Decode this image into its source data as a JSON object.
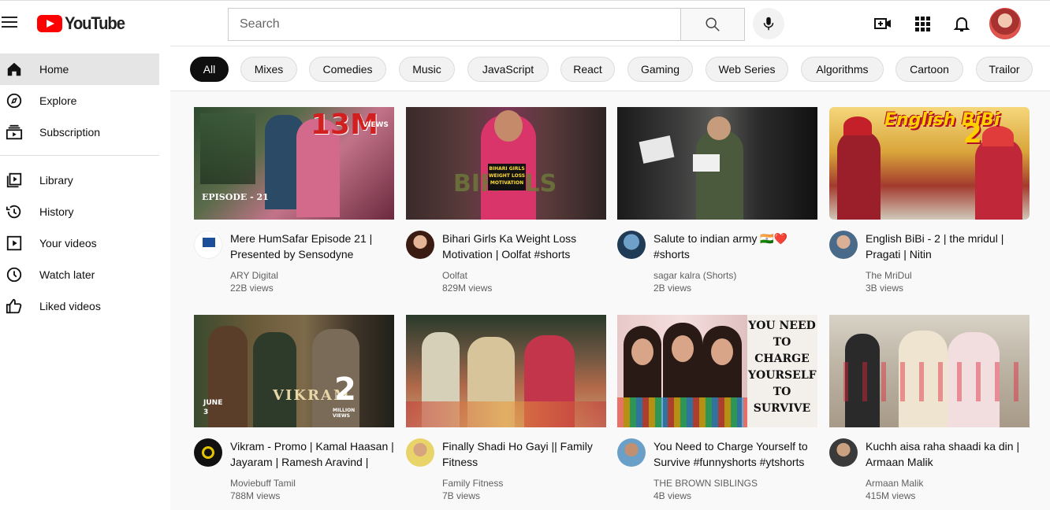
{
  "header": {
    "logo_text": "YouTube",
    "search_placeholder": "Search"
  },
  "sidebar": {
    "items": [
      {
        "label": "Home",
        "icon": "home-icon"
      },
      {
        "label": "Explore",
        "icon": "compass-icon"
      },
      {
        "label": "Subscription",
        "icon": "subscriptions-icon"
      },
      {
        "label": "Library",
        "icon": "library-icon"
      },
      {
        "label": "History",
        "icon": "history-icon"
      },
      {
        "label": "Your videos",
        "icon": "your-videos-icon"
      },
      {
        "label": "Watch later",
        "icon": "clock-icon"
      },
      {
        "label": "Liked videos",
        "icon": "thumbs-up-icon"
      }
    ]
  },
  "chips": [
    "All",
    "Mixes",
    "Comedies",
    "Music",
    "JavaScript",
    "React",
    "Gaming",
    "Web Series",
    "Algorithms",
    "Cartoon",
    "Trailor"
  ],
  "videos": [
    {
      "title": "Mere HumSafar Episode 21 | Presented by Sensodyne",
      "channel": "ARY Digital",
      "views": "22B views",
      "thumb_text": "13M",
      "thumb_sub": "EPISODE - 21",
      "thumb_badge": "VIEWS"
    },
    {
      "title": "Bihari Girls Ka Weight Loss Motivation | Oolfat #shorts",
      "channel": "Oolfat",
      "views": "829M views",
      "thumb_text": "BIHARI GIRLS WEIGHT LOSS MOTIVATION"
    },
    {
      "title": "Salute to indian army 🇮🇳❤️ #shorts",
      "channel": "sagar kalra (Shorts)",
      "views": "2B views"
    },
    {
      "title": "English BiBi - 2 | the mridul | Pragati | Nitin",
      "channel": "The MriDul",
      "views": "3B views",
      "thumb_text": "English BiBi",
      "thumb_sub": "2"
    },
    {
      "title": "Vikram - Promo | Kamal Haasan | Jayaram | Ramesh Aravind |",
      "channel": "Moviebuff Tamil",
      "views": "788M views",
      "thumb_text": "VIKRAM",
      "thumb_sub": "2",
      "thumb_badge": "MILLION VIEWS",
      "thumb_date": "JUNE 3"
    },
    {
      "title": "Finally Shadi Ho Gayi || Family Fitness",
      "channel": "Family Fitness",
      "views": "7B views"
    },
    {
      "title": "You Need to Charge Yourself to Survive #funnyshorts #ytshorts",
      "channel": "THE BROWN SIBLINGS",
      "views": "4B views",
      "thumb_text": "YOU NEED TO CHARGE YOURSELF TO SURVIVE"
    },
    {
      "title": "Kuchh aisa raha shaadi ka din | Armaan Malik",
      "channel": "Armaan Malik",
      "views": "415M views"
    }
  ]
}
